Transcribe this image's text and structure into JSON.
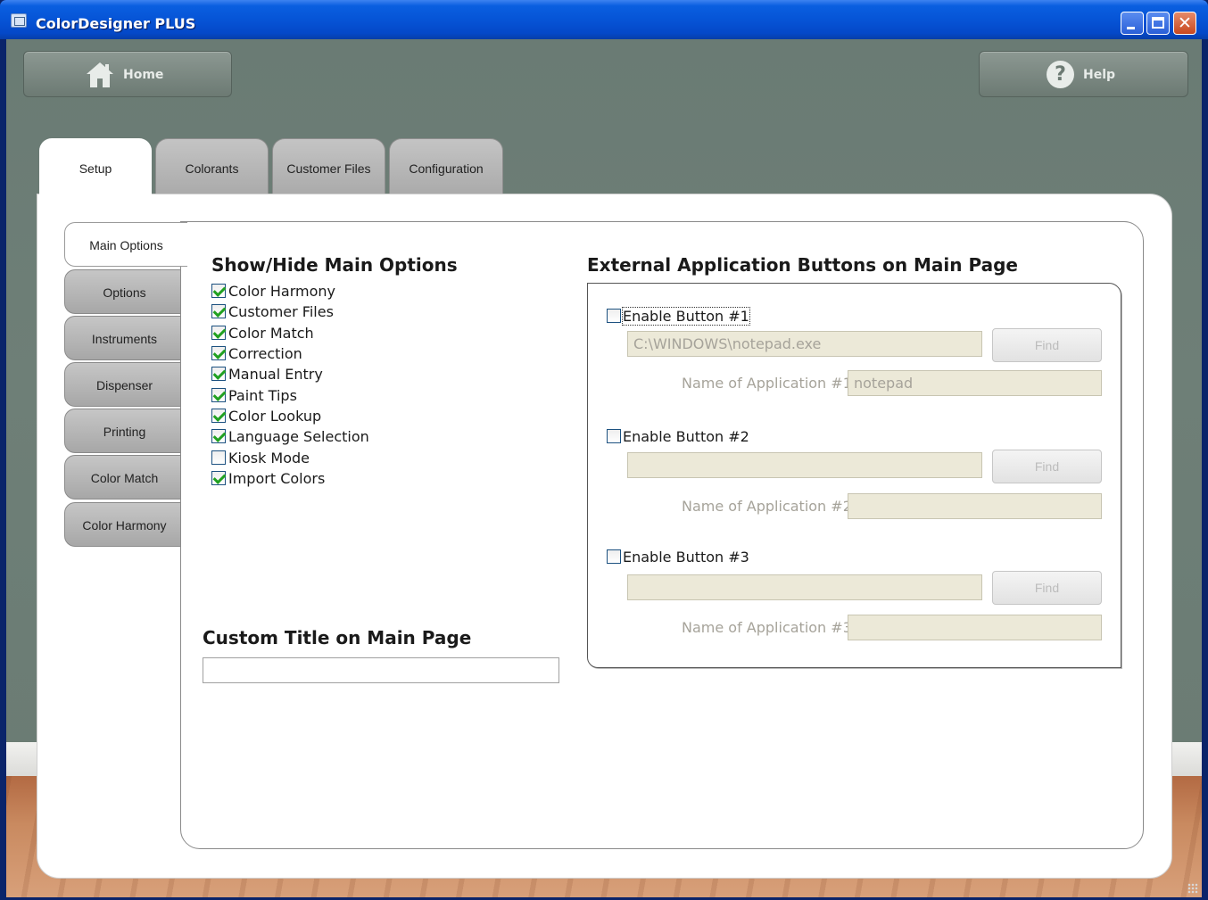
{
  "window": {
    "title": "ColorDesigner PLUS",
    "controls": {
      "minimize": "minimize",
      "maximize": "maximize",
      "close": "✕"
    }
  },
  "toolbar": {
    "home_label": "Home",
    "help_label": "Help"
  },
  "top_tabs": [
    {
      "label": "Setup",
      "active": true
    },
    {
      "label": "Colorants",
      "active": false
    },
    {
      "label": "Customer Files",
      "active": false
    },
    {
      "label": "Configuration",
      "active": false
    }
  ],
  "side_tabs": [
    {
      "label": "Main Options",
      "active": true
    },
    {
      "label": "Options",
      "active": false
    },
    {
      "label": "Instruments",
      "active": false
    },
    {
      "label": "Dispenser",
      "active": false
    },
    {
      "label": "Printing",
      "active": false
    },
    {
      "label": "Color Match",
      "active": false
    },
    {
      "label": "Color Harmony",
      "active": false
    }
  ],
  "show_hide": {
    "title": "Show/Hide Main Options",
    "options": [
      {
        "label": "Color Harmony",
        "checked": true
      },
      {
        "label": "Customer Files",
        "checked": true
      },
      {
        "label": "Color Match",
        "checked": true
      },
      {
        "label": "Correction",
        "checked": true
      },
      {
        "label": "Manual Entry",
        "checked": true
      },
      {
        "label": "Paint Tips",
        "checked": true
      },
      {
        "label": "Color Lookup",
        "checked": true
      },
      {
        "label": "Language Selection",
        "checked": true
      },
      {
        "label": "Kiosk Mode",
        "checked": false
      },
      {
        "label": "Import Colors",
        "checked": true
      }
    ]
  },
  "custom_title": {
    "title": "Custom Title on Main Page",
    "value": ""
  },
  "external": {
    "title": "External Application Buttons on Main Page",
    "buttons": [
      {
        "enable_label": "Enable Button #1",
        "checked": false,
        "path": "C:\\WINDOWS\\notepad.exe",
        "find_label": "Find",
        "name_label": "Name of Application #1",
        "name_value": "notepad"
      },
      {
        "enable_label": "Enable Button #2",
        "checked": false,
        "path": "",
        "find_label": "Find",
        "name_label": "Name of Application #2",
        "name_value": ""
      },
      {
        "enable_label": "Enable Button #3",
        "checked": false,
        "path": "",
        "find_label": "Find",
        "name_label": "Name of Application #3",
        "name_value": ""
      }
    ]
  },
  "colors": {
    "titlebar": "#0654d6",
    "wall": "#6e7f77",
    "floor": "#c98a60",
    "check": "#21a121",
    "disabled_field": "#ece9d8"
  },
  "icons": {
    "home": "house-icon",
    "help": "question-circle-icon",
    "app": "app-window-icon"
  }
}
